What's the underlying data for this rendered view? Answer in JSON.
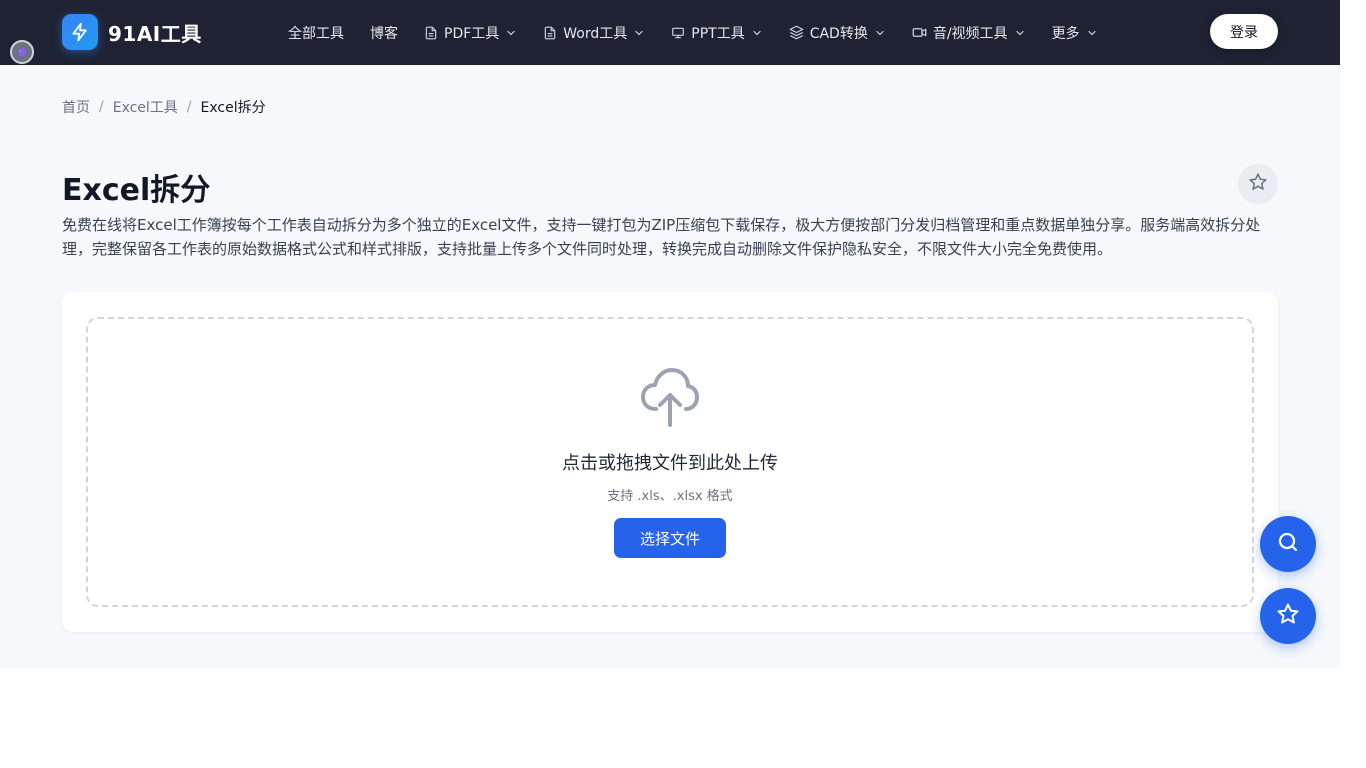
{
  "brand": {
    "name": "91AI工具"
  },
  "nav": [
    {
      "label": "全部工具",
      "icon": "",
      "dropdown": false
    },
    {
      "label": "博客",
      "icon": "",
      "dropdown": false
    },
    {
      "label": "PDF工具",
      "icon": "document-icon",
      "dropdown": true
    },
    {
      "label": "Word工具",
      "icon": "document-icon",
      "dropdown": true
    },
    {
      "label": "PPT工具",
      "icon": "presentation-icon",
      "dropdown": true
    },
    {
      "label": "CAD转换",
      "icon": "layers-icon",
      "dropdown": true
    },
    {
      "label": "音/视频工具",
      "icon": "video-icon",
      "dropdown": true
    },
    {
      "label": "更多",
      "icon": "",
      "dropdown": true
    }
  ],
  "header": {
    "login_label": "登录"
  },
  "breadcrumb": {
    "home": "首页",
    "category": "Excel工具",
    "current": "Excel拆分",
    "separator": "/"
  },
  "page": {
    "title": "Excel拆分",
    "description": "免费在线将Excel工作簿按每个工作表自动拆分为多个独立的Excel文件，支持一键打包为ZIP压缩包下载保存，极大方便按部门分发归档管理和重点数据单独分享。服务端高效拆分处理，完整保留各工作表的原始数据格式公式和样式排版，支持批量上传多个文件同时处理，转换完成自动删除文件保护隐私安全，不限文件大小完全免费使用。"
  },
  "upload": {
    "title": "点击或拖拽文件到此处上传",
    "hint": "支持 .xls、.xlsx 格式",
    "button_label": "选择文件"
  },
  "colors": {
    "header_bg": "#1e2233",
    "accent": "#2563eb",
    "page_bg": "#f6f8fb"
  }
}
